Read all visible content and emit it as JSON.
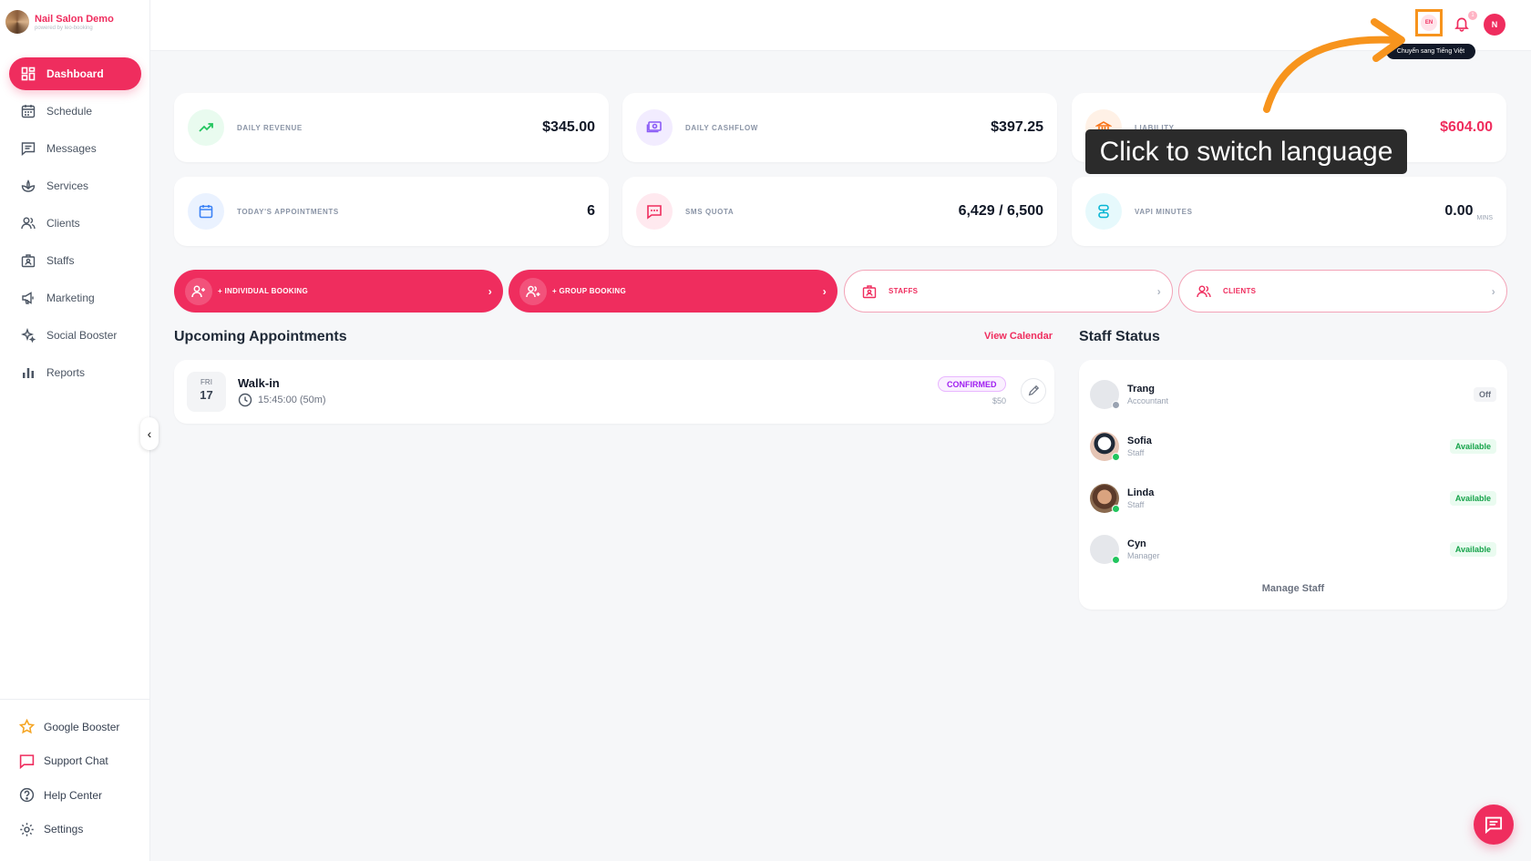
{
  "brand": {
    "name": "Nail Salon Demo",
    "subtitle": "powered by leo-booking"
  },
  "sidebar": {
    "items": [
      {
        "label": "Dashboard",
        "icon": "dashboard-icon",
        "active": true
      },
      {
        "label": "Schedule",
        "icon": "calendar-icon"
      },
      {
        "label": "Messages",
        "icon": "message-icon"
      },
      {
        "label": "Services",
        "icon": "lotus-icon"
      },
      {
        "label": "Clients",
        "icon": "users-icon"
      },
      {
        "label": "Staffs",
        "icon": "staff-icon"
      },
      {
        "label": "Marketing",
        "icon": "megaphone-icon"
      },
      {
        "label": "Social Booster",
        "icon": "sparkles-icon"
      },
      {
        "label": "Reports",
        "icon": "bar-chart-icon"
      }
    ],
    "bottom": [
      {
        "label": "Google Booster",
        "icon": "star-icon"
      },
      {
        "label": "Support Chat",
        "icon": "chat-icon"
      },
      {
        "label": "Help Center",
        "icon": "help-icon"
      },
      {
        "label": "Settings",
        "icon": "gear-icon"
      }
    ]
  },
  "topbar": {
    "lang": "EN",
    "notification_count": "1",
    "avatar_initial": "N",
    "lang_tooltip": "Chuyển sang Tiếng Việt"
  },
  "stats": [
    {
      "label": "DAILY REVENUE",
      "value": "$345.00",
      "color": "#22c55e"
    },
    {
      "label": "DAILY CASHFLOW",
      "value": "$397.25",
      "color": "#8b5cf6"
    },
    {
      "label": "LIABILITY",
      "value": "$604.00",
      "color": "#f97316"
    },
    {
      "label": "TODAY'S APPOINTMENTS",
      "value": "6",
      "color": "#3b82f6"
    },
    {
      "label": "SMS QUOTA",
      "value": "6,429 / 6,500",
      "color": "#ef2d5e"
    },
    {
      "label": "VAPI MINUTES",
      "value": "0.00",
      "unit": "MINS",
      "color": "#06b6d4"
    }
  ],
  "actions": [
    {
      "label": "+ INDIVIDUAL BOOKING"
    },
    {
      "label": "+ GROUP BOOKING"
    },
    {
      "label": "STAFFS"
    },
    {
      "label": "CLIENTS"
    }
  ],
  "upcoming": {
    "title": "Upcoming Appointments",
    "view_calendar": "View Calendar",
    "items": [
      {
        "dow": "FRI",
        "day": "17",
        "name": "Walk-in",
        "time": "15:45:00 (50m)",
        "status": "CONFIRMED",
        "price": "$50"
      }
    ]
  },
  "staff_status": {
    "title": "Staff Status",
    "manage": "Manage Staff",
    "staff": [
      {
        "name": "Trang",
        "role": "Accountant",
        "status": "Off"
      },
      {
        "name": "Sofia",
        "role": "Staff",
        "status": "Available"
      },
      {
        "name": "Linda",
        "role": "Staff",
        "status": "Available"
      },
      {
        "name": "Cyn",
        "role": "Manager",
        "status": "Available"
      }
    ]
  },
  "overlay": {
    "tooltip": "Click to switch language"
  },
  "colors": {
    "accent": "#ef2d5e",
    "highlight": "#f7941d",
    "available": "#16a34a"
  }
}
